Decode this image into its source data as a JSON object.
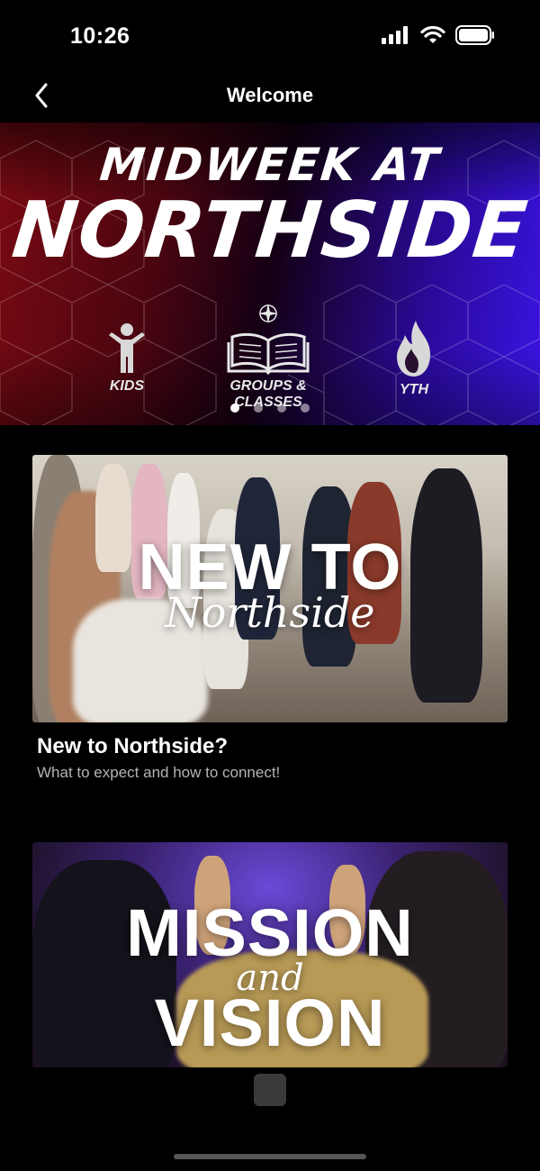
{
  "status_bar": {
    "time": "10:26"
  },
  "nav": {
    "title": "Welcome"
  },
  "hero": {
    "line1": "MIDWEEK AT",
    "line2": "NORTHSIDE",
    "ministries": [
      {
        "label": "KIDS",
        "icon": "child-icon"
      },
      {
        "label": "GROUPS & CLASSES",
        "icon": "open-book-icon"
      },
      {
        "label": "YTH",
        "icon": "flame-icon"
      }
    ],
    "page_count": 4,
    "active_page": 1
  },
  "cards": [
    {
      "image_title": "NEW TO",
      "image_script": "Northside",
      "title": "New to Northside?",
      "subtitle": "What to expect and how to connect!"
    },
    {
      "image_title_1": "MISSION",
      "image_script": "and",
      "image_title_2": "VISION"
    }
  ],
  "colors": {
    "background": "#000000",
    "hero_red": "#7a0a12",
    "hero_blue": "#3b14e6",
    "subtitle": "#b3b3b3"
  }
}
